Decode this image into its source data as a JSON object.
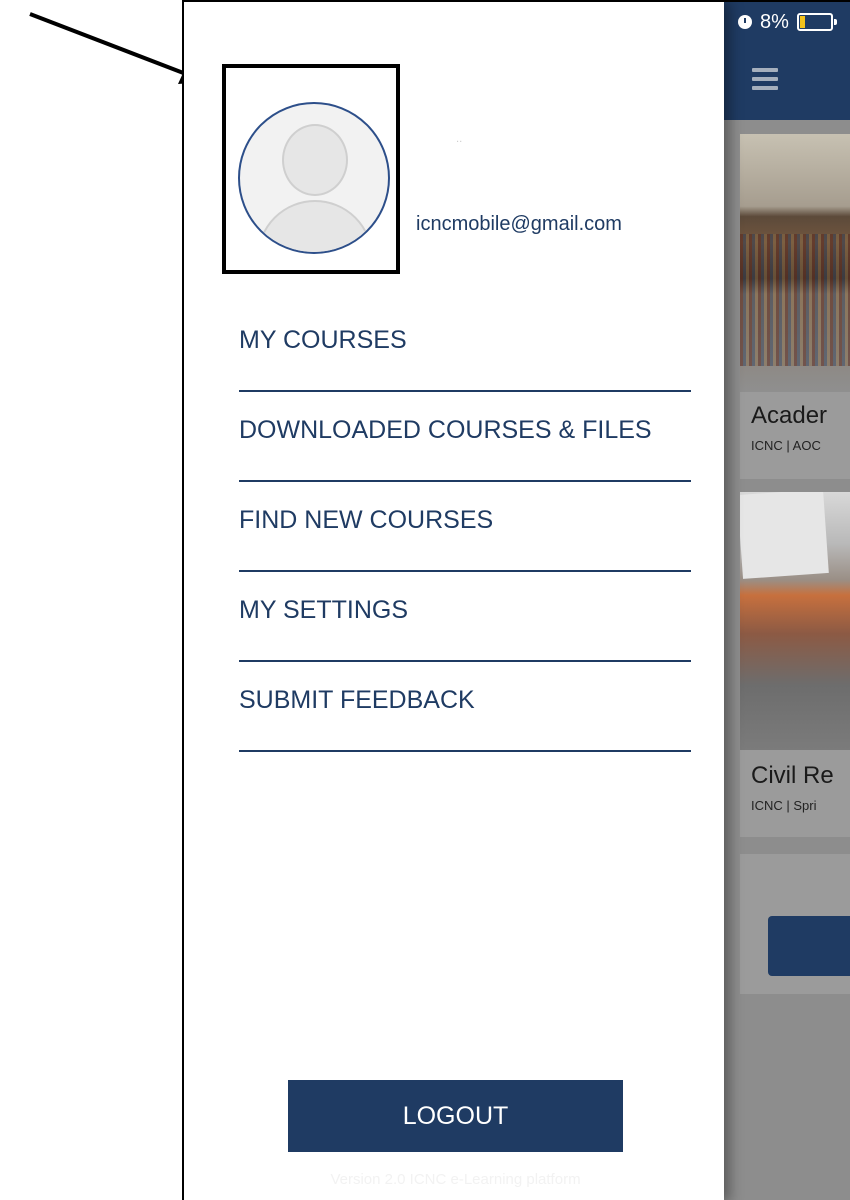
{
  "status_bar": {
    "battery_percent": "8%",
    "battery_level": 0.08,
    "icons": [
      "alarm-icon",
      "battery-icon"
    ]
  },
  "app_bar": {
    "menu_icon": "hamburger-icon"
  },
  "background": {
    "cards": [
      {
        "title": "Acader",
        "subtitle": "ICNC | AOC"
      },
      {
        "title": "Civil Re",
        "subtitle": "ICNC | Spri"
      }
    ]
  },
  "drawer": {
    "user": {
      "name_placeholder": "..",
      "email": "icncmobile@gmail.com"
    },
    "menu_items": [
      {
        "label": "MY COURSES"
      },
      {
        "label": "DOWNLOADED COURSES & FILES"
      },
      {
        "label": "FIND NEW COURSES"
      },
      {
        "label": "MY SETTINGS"
      },
      {
        "label": "SUBMIT FEEDBACK"
      }
    ],
    "logout_label": "LOGOUT",
    "version_text": "Version 2.0 ICNC e-Learning platform"
  },
  "colors": {
    "brand": "#1f3b63",
    "annotation": "#000000"
  }
}
